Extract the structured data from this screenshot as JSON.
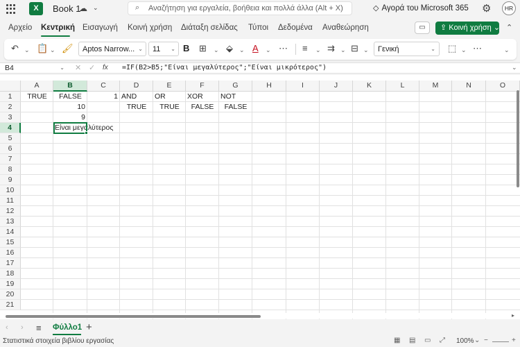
{
  "titlebar": {
    "logo_letter": "X",
    "doc_title": "Book 1",
    "search_placeholder": "Αναζήτηση για εργαλεία, βοήθεια και πολλά άλλα (Alt + X)",
    "buy_label": "Αγορά του Microsoft 365",
    "avatar_initials": "HR"
  },
  "menu": {
    "items": [
      "Αρχείο",
      "Κεντρική",
      "Εισαγωγή",
      "Κοινή χρήση",
      "Διάταξη σελίδας",
      "Τύποι",
      "Δεδομένα",
      "Αναθεώρηση"
    ],
    "active": "Κεντρική",
    "share_label": "Κοινή χρήση"
  },
  "ribbon": {
    "font_name": "Aptos Narrow...",
    "font_size": "11",
    "number_format": "Γενική",
    "bold": "B"
  },
  "formula_bar": {
    "name_box": "B4",
    "fx": "fx",
    "formula": "=IF(B2>B5;\"Είναι μεγαλύτερος\";\"Είναι μικρότερος\")"
  },
  "grid": {
    "columns": [
      "A",
      "B",
      "C",
      "D",
      "E",
      "F",
      "G",
      "H",
      "I",
      "J",
      "K",
      "L",
      "M",
      "N",
      "O"
    ],
    "rows": [
      "1",
      "2",
      "3",
      "4",
      "5",
      "6",
      "7",
      "8",
      "9",
      "10",
      "11",
      "12",
      "13",
      "14",
      "15",
      "16",
      "17",
      "18",
      "19",
      "20",
      "21"
    ],
    "selected_column": "B",
    "selected_row": "4",
    "cells": {
      "A1": "TRUE",
      "B1": "FALSE",
      "C1": "1",
      "D1": "AND",
      "E1": "OR",
      "F1": "XOR",
      "G1": "NOT",
      "B2": "10",
      "D2": "TRUE",
      "E2": "TRUE",
      "F2": "FALSE",
      "G2": "FALSE",
      "B3": "9",
      "B4": "Είναι μεγαλύτερος"
    }
  },
  "sheets": {
    "active": "Φύλλο1"
  },
  "status": {
    "text": "Στατιστικά στοιχεία βιβλίου εργασίας",
    "zoom": "100%"
  }
}
